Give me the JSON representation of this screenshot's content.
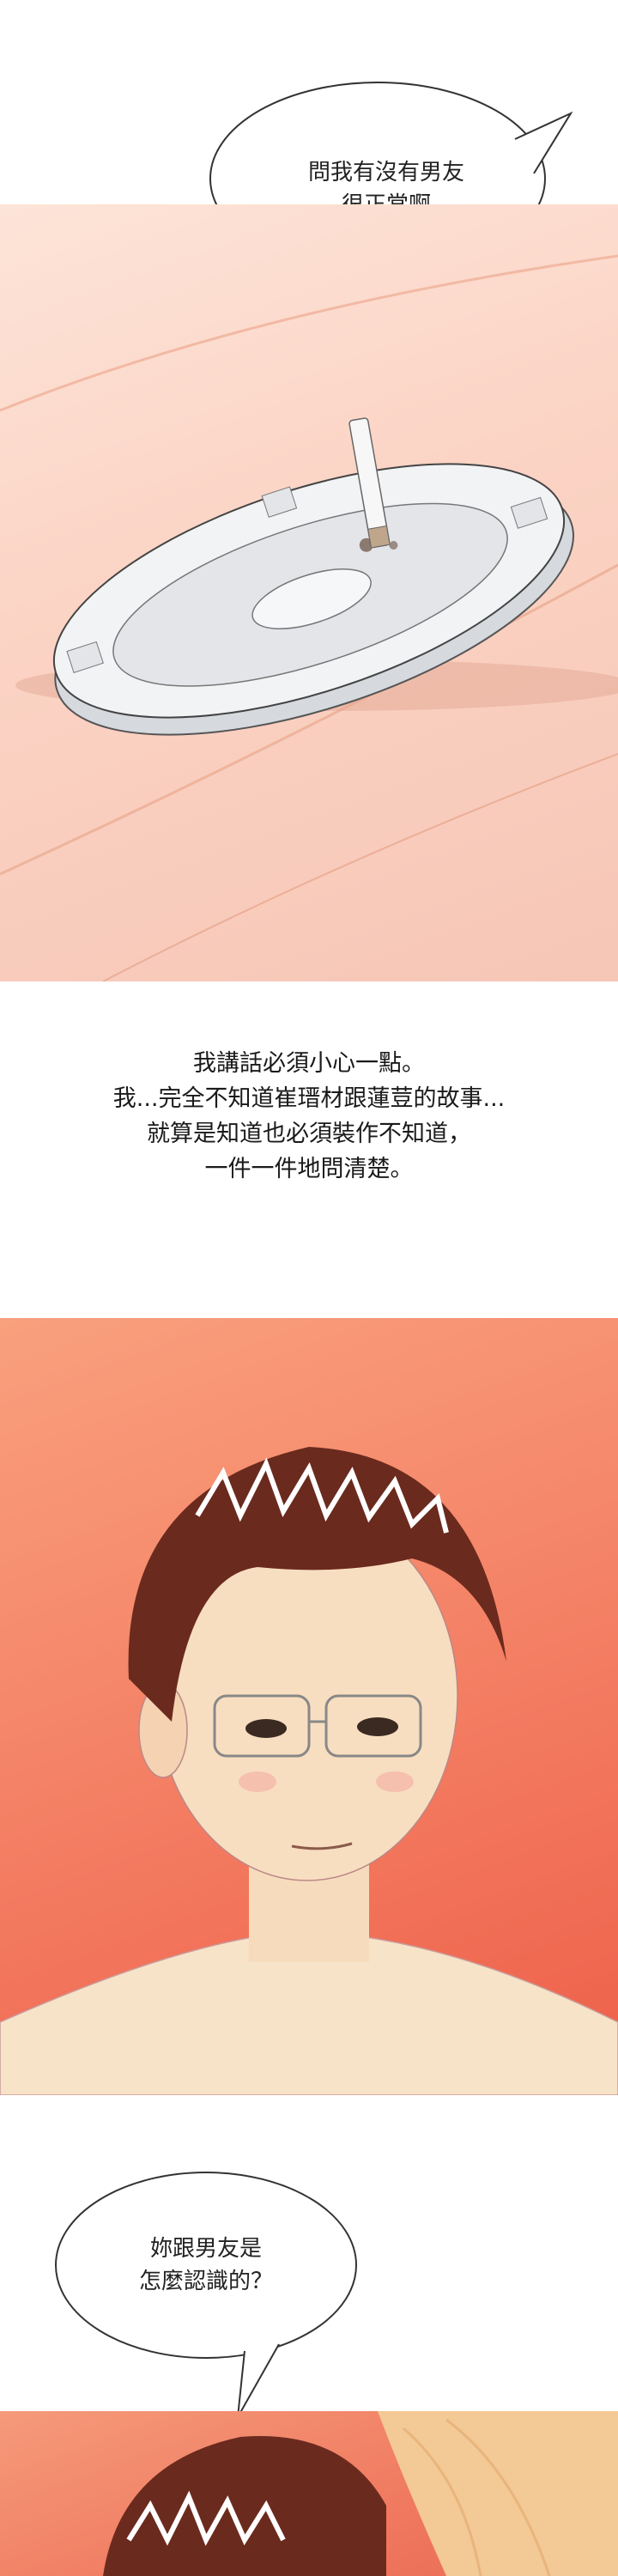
{
  "bubble_top": {
    "lines": [
      "問我有沒有男友",
      "很正常啊"
    ]
  },
  "narration": {
    "lines": [
      "我講話必須小心一點。",
      "我...完全不知道崔瑨材跟蓮荳的故事...",
      "就算是知道也必須裝作不知道，",
      "一件一件地問清楚。"
    ]
  },
  "bubble_bottom": {
    "lines": [
      "妳跟男友是",
      "怎麼認識的？"
    ]
  },
  "colors": {
    "panel1_bg": "#fbd3c4",
    "panel2_bg": "#f5876a",
    "hair": "#6b2a1e",
    "skin": "#f7d9b8"
  }
}
